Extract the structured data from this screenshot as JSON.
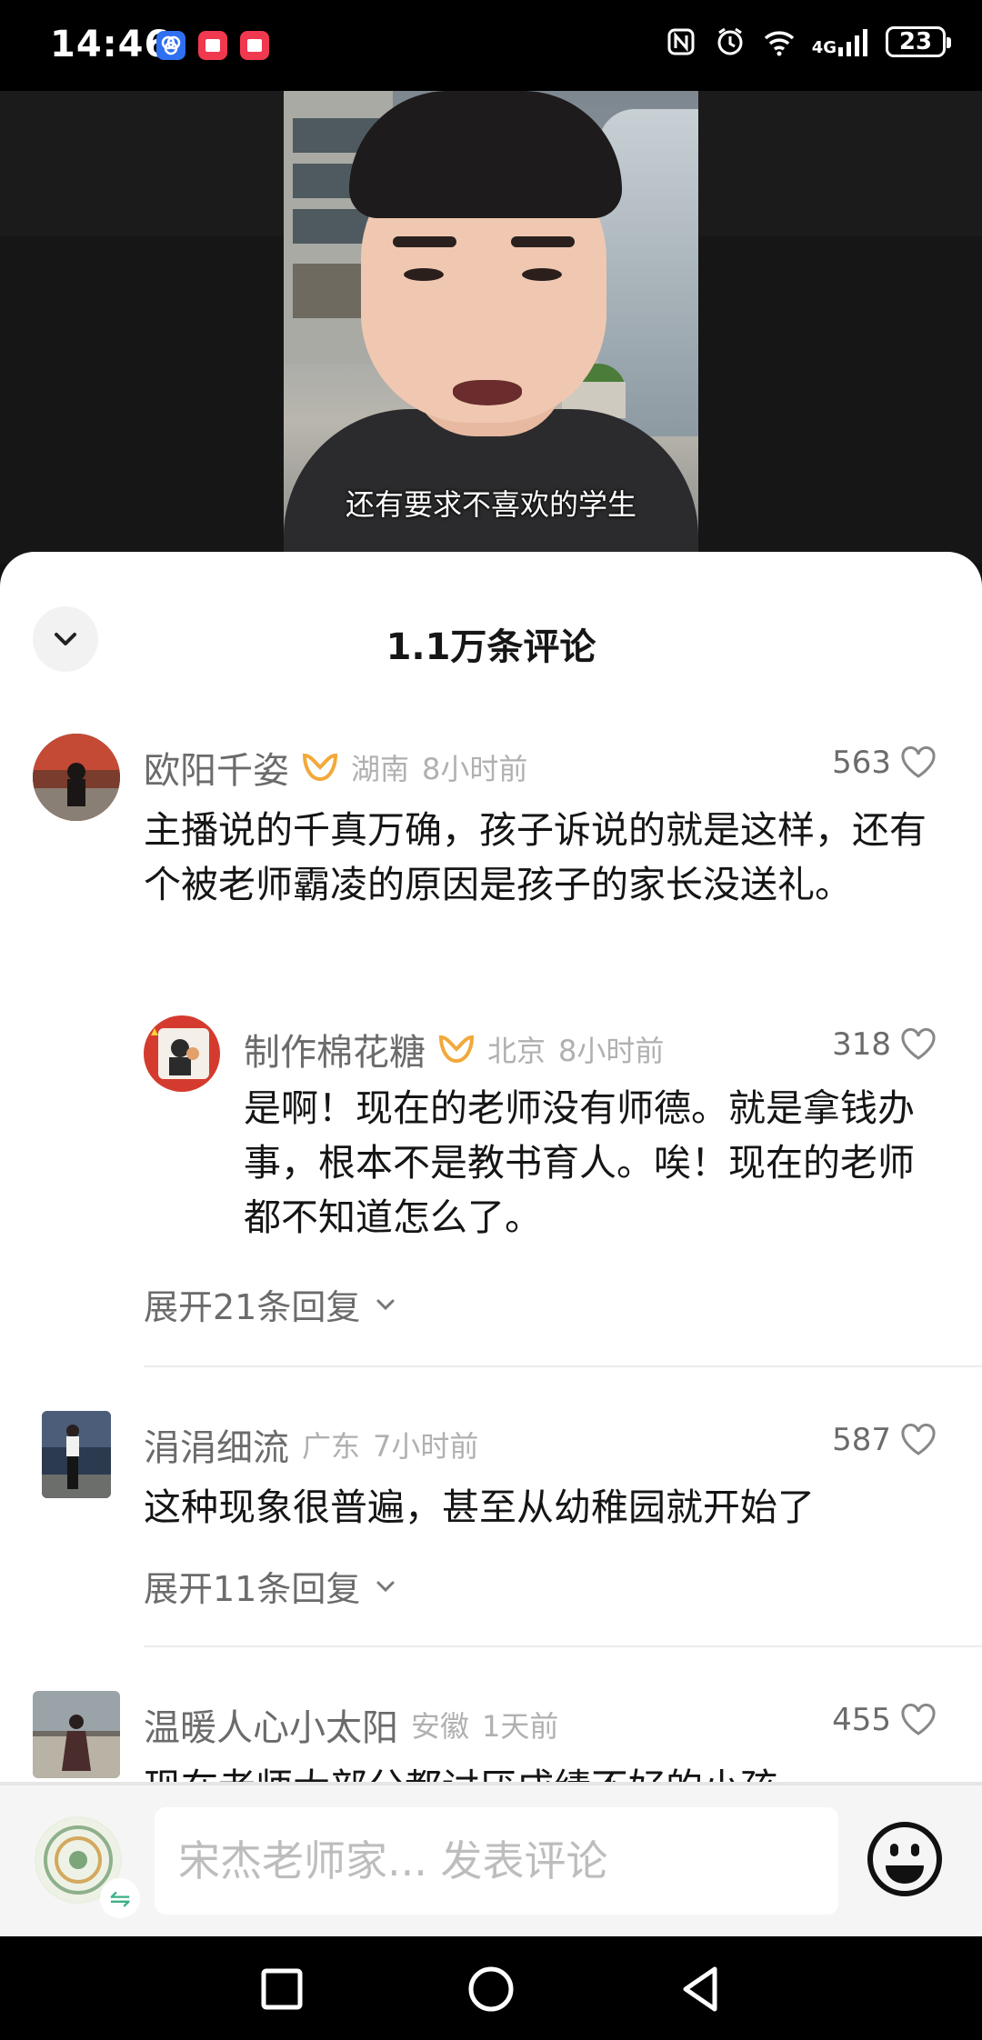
{
  "status_bar": {
    "time": "14:46",
    "network": "4G",
    "battery": "23",
    "left_icons": [
      "app-notification-icon",
      "app-notification-icon",
      "app-notification-icon"
    ],
    "right_icons": [
      "nfc-icon",
      "alarm-icon",
      "wifi-icon",
      "signal-icon",
      "battery-icon"
    ]
  },
  "video": {
    "subtitle": "还有要求不喜欢的学生"
  },
  "comments_sheet": {
    "title": "1.1万条评论",
    "comments": [
      {
        "username": "欧阳千姿",
        "location": "湖南",
        "time": "8小时前",
        "likes": "563",
        "text": "主播说的千真万确，孩子诉说的就是这样，还有个被老师霸凌的原因是孩子的家长没送礼。",
        "reply": {
          "username": "制作棉花糖",
          "location": "北京",
          "time": "8小时前",
          "likes": "318",
          "text": "是啊！现在的老师没有师德。就是拿钱办事，根本不是教书育人。唉！现在的老师都不知道怎么了。"
        },
        "expand_label": "展开21条回复"
      },
      {
        "username": "涓涓细流",
        "location": "广东",
        "time": "7小时前",
        "likes": "587",
        "text": "这种现象很普遍，甚至从幼稚园就开始了",
        "expand_label": "展开11条回复"
      },
      {
        "username": "温暖人心小太阳",
        "location": "安徽",
        "time": "1天前",
        "likes": "455",
        "text": "现在老师大部分都讨厌成绩不好的小孩"
      }
    ]
  },
  "bottom_bar": {
    "input_placeholder": "宋杰老师家... 发表评论"
  },
  "colors": {
    "accent_vip": "#f2a93b",
    "text_primary": "#151515",
    "text_secondary": "#6b6b6b",
    "text_tertiary": "#b0b0b0"
  }
}
